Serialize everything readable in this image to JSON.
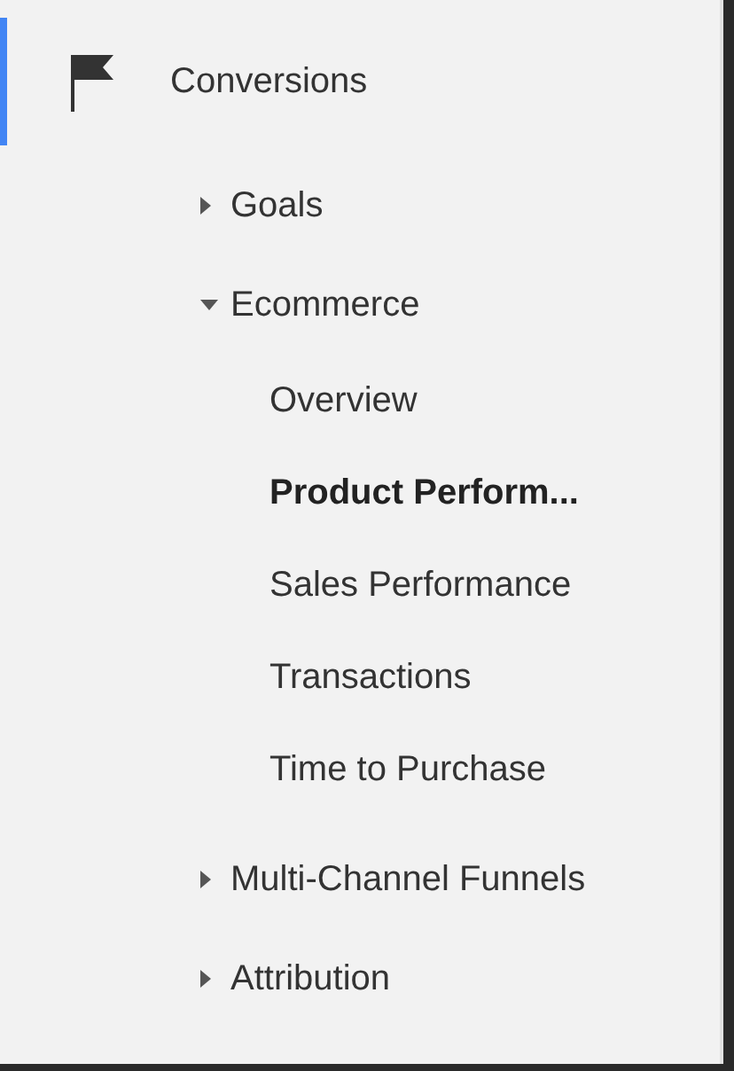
{
  "section": {
    "title": "Conversions",
    "active": true
  },
  "items": [
    {
      "label": "Goals",
      "expanded": false
    },
    {
      "label": "Ecommerce",
      "expanded": true,
      "children": [
        {
          "label": "Overview",
          "selected": false
        },
        {
          "label": "Product Perform...",
          "selected": true
        },
        {
          "label": "Sales Performance",
          "selected": false
        },
        {
          "label": "Transactions",
          "selected": false
        },
        {
          "label": "Time to Purchase",
          "selected": false
        }
      ]
    },
    {
      "label": "Multi-Channel Funnels",
      "expanded": false
    },
    {
      "label": "Attribution",
      "expanded": false
    }
  ]
}
